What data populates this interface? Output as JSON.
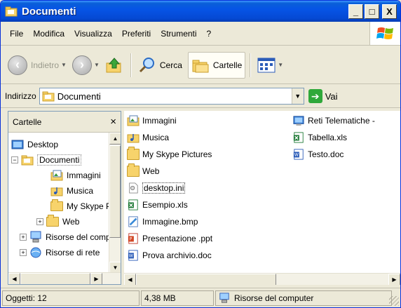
{
  "window": {
    "title": "Documenti",
    "controls": {
      "minimize": "_",
      "maximize": "□",
      "close": "X"
    }
  },
  "menu": {
    "items": [
      "File",
      "Modifica",
      "Visualizza",
      "Preferiti",
      "Strumenti",
      "?"
    ]
  },
  "toolbar": {
    "back_label": "Indietro",
    "search_label": "Cerca",
    "folders_label": "Cartelle"
  },
  "address": {
    "label": "Indirizzo",
    "value": "Documenti",
    "go_label": "Vai"
  },
  "folders_pane": {
    "title": "Cartelle",
    "close": "×",
    "tree": [
      {
        "label": "Desktop",
        "icon": "desktop-icon"
      },
      {
        "label": "Documenti",
        "icon": "documents-folder-icon",
        "expander": "−",
        "selected": true
      },
      {
        "label": "Immagini",
        "icon": "pictures-folder-icon"
      },
      {
        "label": "Musica",
        "icon": "music-folder-icon"
      },
      {
        "label": "My Skype Pictures",
        "icon": "folder-icon"
      },
      {
        "label": "Web",
        "icon": "folder-icon",
        "expander": "+"
      },
      {
        "label": "Risorse del computer",
        "icon": "my-computer-icon",
        "expander": "+"
      },
      {
        "label": "Risorse di rete",
        "icon": "network-icon",
        "expander": "+"
      }
    ]
  },
  "files": {
    "column1": [
      {
        "name": "Immagini",
        "icon": "pictures-folder-icon"
      },
      {
        "name": "Musica",
        "icon": "music-folder-icon"
      },
      {
        "name": "My Skype Pictures",
        "icon": "folder-icon"
      },
      {
        "name": "Web",
        "icon": "folder-icon"
      },
      {
        "name": "desktop.ini",
        "icon": "ini-file-icon",
        "focused": true
      },
      {
        "name": "Esempio.xls",
        "icon": "excel-file-icon"
      },
      {
        "name": "Immagine.bmp",
        "icon": "bitmap-file-icon"
      },
      {
        "name": "Presentazione .ppt",
        "icon": "powerpoint-file-icon"
      },
      {
        "name": "Prova archivio.doc",
        "icon": "word-file-icon"
      }
    ],
    "column2": [
      {
        "name": "Reti Telematiche - ",
        "icon": "shortcut-icon"
      },
      {
        "name": "Tabella.xls",
        "icon": "excel-file-icon"
      },
      {
        "name": "Testo.doc",
        "icon": "word-file-icon"
      }
    ]
  },
  "status": {
    "objects": "Oggetti: 12",
    "size": "4,38 MB",
    "location": "Risorse del computer"
  },
  "colors": {
    "titlebar": "#0654e6",
    "window_bg": "#ece9d8",
    "border": "#7f9db9"
  }
}
